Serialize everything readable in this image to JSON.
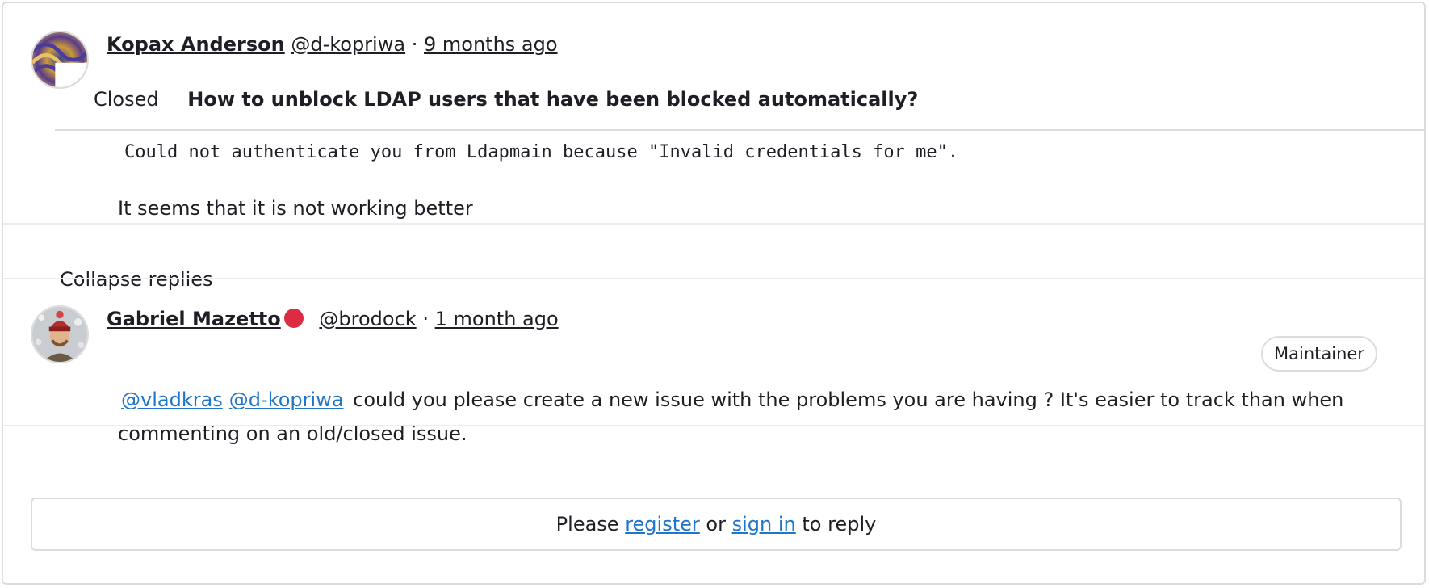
{
  "original_note": {
    "author_name": "Kopax Anderson",
    "author_handle": "@d-kopriwa",
    "separator": "·",
    "time_ago": "9 months ago",
    "status": "Closed",
    "issue_title": "How to unblock LDAP users that have been blocked automatically?",
    "code_text": "Could not authenticate you from Ldapmain because \"Invalid credentials for me\".",
    "body_text": "It seems that it is not working better"
  },
  "collapse_replies_label": "Collapse replies",
  "reply_note": {
    "author_name": "Gabriel Mazetto",
    "status_color": "#dd2b44",
    "author_handle": "@brodock",
    "separator": "·",
    "time_ago": "1 month ago",
    "role_badge": "Maintainer",
    "mention_1": "@vladkras",
    "mention_2": "@d-kopriwa",
    "body_text": "could you please create a new issue with the problems you are having ? It's easier to track than when commenting on an old/closed issue."
  },
  "reply_prompt": {
    "prefix": "Please",
    "register_link": "register",
    "middle": "or",
    "sign_in_link": "sign in",
    "suffix": "to reply"
  },
  "colors": {
    "link": "#1f75cb",
    "border": "#dcdcde",
    "text": "#1f1e24"
  }
}
